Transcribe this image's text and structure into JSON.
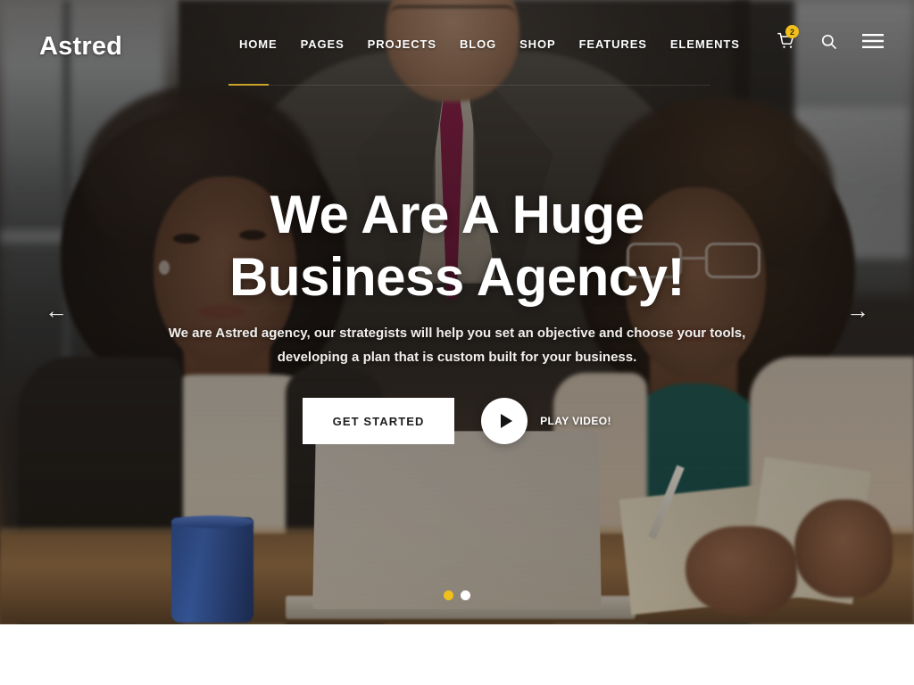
{
  "site": {
    "logo_text": "Astred"
  },
  "header": {
    "nav_items": [
      {
        "label": "HOME",
        "active": true
      },
      {
        "label": "PAGES",
        "active": false
      },
      {
        "label": "PROJECTS",
        "active": false
      },
      {
        "label": "BLOG",
        "active": false
      },
      {
        "label": "SHOP",
        "active": false
      },
      {
        "label": "FEATURES",
        "active": false
      },
      {
        "label": "ELEMENTS",
        "active": false
      }
    ],
    "icons": {
      "cart": "cart-icon",
      "cart_badge_count": "2",
      "search": "search-icon",
      "menu": "hamburger-menu-icon"
    },
    "accent_color": "#f2c01a",
    "active_underline_color": "#c9a227"
  },
  "hero": {
    "headline_line1": "We Are A Huge",
    "headline_line2": "Business Agency!",
    "subtext": "We are Astred agency, our strategists will help you set an objective and choose your tools, developing a plan that is custom built for your business.",
    "primary_button": "GET STARTED",
    "play_label": "PLAY VIDEO!",
    "play_icon": "play-triangle-icon",
    "prev_arrow": "←",
    "next_arrow": "→",
    "slides": [
      {
        "index": 1,
        "active": true
      },
      {
        "index": 2,
        "active": false
      }
    ]
  }
}
